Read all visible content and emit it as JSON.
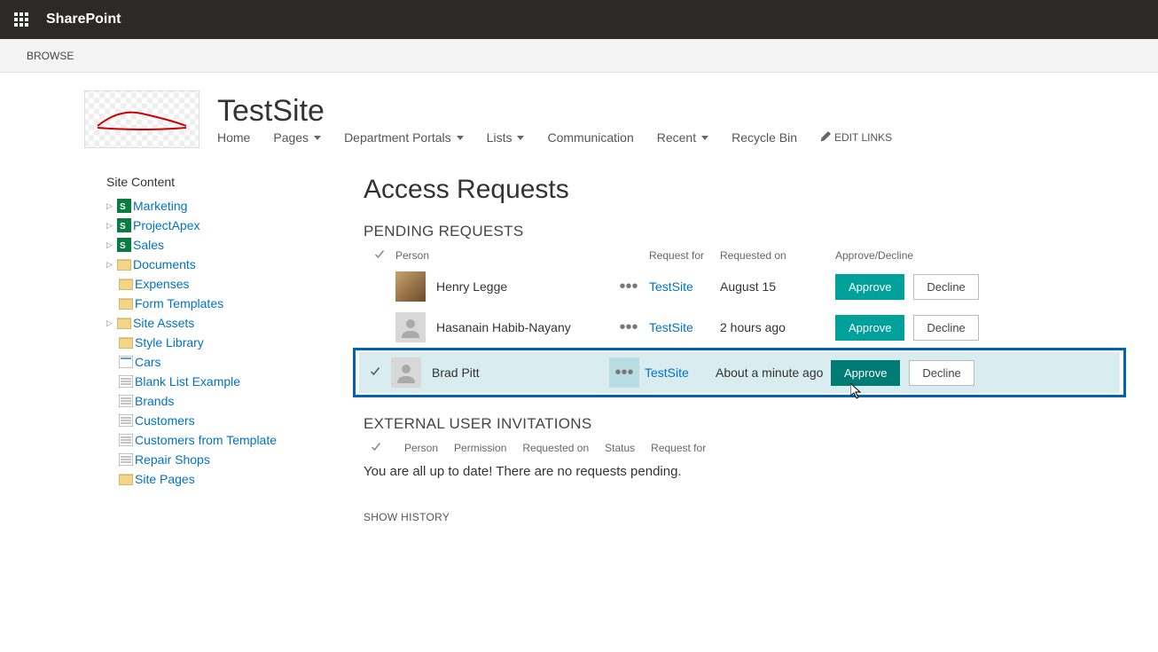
{
  "suitebar": {
    "brand": "SharePoint"
  },
  "ribbon": {
    "browse": "BROWSE"
  },
  "site": {
    "title": "TestSite",
    "nav": {
      "home": "Home",
      "pages": "Pages",
      "dept": "Department Portals",
      "lists": "Lists",
      "comm": "Communication",
      "recent": "Recent",
      "recycle": "Recycle Bin",
      "edit_links": "EDIT LINKS"
    }
  },
  "sidebar": {
    "heading": "Site Content",
    "items": {
      "marketing": "Marketing",
      "projectapex": "ProjectApex",
      "sales": "Sales",
      "documents": "Documents",
      "expenses": "Expenses",
      "formtemplates": "Form Templates",
      "siteassets": "Site Assets",
      "stylelibrary": "Style Library",
      "cars": "Cars",
      "blanklist": "Blank List Example",
      "brands": "Brands",
      "customers": "Customers",
      "customerstpl": "Customers from Template",
      "repairshops": "Repair Shops",
      "sitepages": "Site Pages"
    }
  },
  "page": {
    "title": "Access Requests",
    "pending_heading": "PENDING REQUESTS",
    "external_heading": "EXTERNAL USER INVITATIONS",
    "show_history": "SHOW HISTORY",
    "empty_external": "You are all up to date! There are no requests pending."
  },
  "columns": {
    "person": "Person",
    "request_for": "Request for",
    "requested_on": "Requested on",
    "approve_decline": "Approve/Decline",
    "permission": "Permission",
    "status": "Status"
  },
  "buttons": {
    "approve": "Approve",
    "decline": "Decline"
  },
  "requests": [
    {
      "person": "Henry Legge",
      "for": "TestSite",
      "on": "August 15",
      "has_photo": true
    },
    {
      "person": "Hasanain Habib-Nayany",
      "for": "TestSite",
      "on": "2 hours ago",
      "has_photo": false
    },
    {
      "person": "Brad Pitt",
      "for": "TestSite",
      "on": "About a minute ago",
      "has_photo": false,
      "selected": true
    }
  ]
}
